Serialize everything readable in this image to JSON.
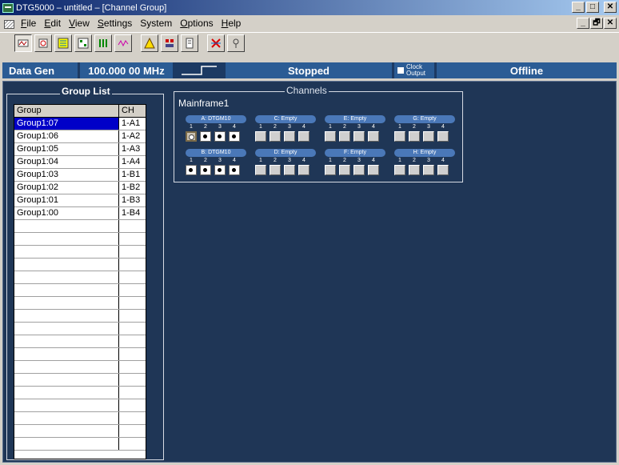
{
  "window": {
    "title": "DTG5000 – untitled – [Channel Group]",
    "controls": [
      "_",
      "□",
      "✕"
    ],
    "mdi_controls": [
      "_",
      "🗗",
      "✕"
    ]
  },
  "menu": {
    "items": [
      {
        "key": "F",
        "rest": "ile"
      },
      {
        "key": "E",
        "rest": "dit"
      },
      {
        "key": "V",
        "rest": "iew"
      },
      {
        "key": "S",
        "rest": "ettings"
      },
      {
        "key": "",
        "rest": "System"
      },
      {
        "key": "O",
        "rest": "ptions"
      },
      {
        "key": "H",
        "rest": "elp"
      }
    ]
  },
  "toolbar": {
    "buttons": [
      "data-gen-icon",
      "settings-icon",
      "pattern-icon",
      "timing-icon",
      "channel-icon",
      "waveform-icon",
      "warning-icon",
      "group-icon",
      "clip-icon",
      "cross-icon",
      "probe-icon"
    ]
  },
  "status": {
    "mode_label": "Data Gen",
    "frequency": "100.000 00 MHz",
    "run_state": "Stopped",
    "clock_output_line1": "Clock",
    "clock_output_line2": "Output",
    "connection": "Offline"
  },
  "group_list": {
    "title": "Group List",
    "columns": [
      "Group",
      "CH"
    ],
    "rows": [
      {
        "group": "Group1:07",
        "ch": "1-A1",
        "selected": true
      },
      {
        "group": "Group1:06",
        "ch": "1-A2",
        "selected": false
      },
      {
        "group": "Group1:05",
        "ch": "1-A3",
        "selected": false
      },
      {
        "group": "Group1:04",
        "ch": "1-A4",
        "selected": false
      },
      {
        "group": "Group1:03",
        "ch": "1-B1",
        "selected": false
      },
      {
        "group": "Group1:02",
        "ch": "1-B2",
        "selected": false
      },
      {
        "group": "Group1:01",
        "ch": "1-B3",
        "selected": false
      },
      {
        "group": "Group1:00",
        "ch": "1-B4",
        "selected": false
      }
    ],
    "empty_rows": 18
  },
  "channels": {
    "title": "Channels",
    "mainframe": "Mainframe1",
    "channel_numbers": [
      "1",
      "2",
      "3",
      "4"
    ],
    "slots": [
      {
        "label": "A: DTGM10",
        "used": true,
        "active_channel": 1
      },
      {
        "label": "C: Empty",
        "used": false,
        "active_channel": 0
      },
      {
        "label": "E: Empty",
        "used": false,
        "active_channel": 0
      },
      {
        "label": "G: Empty",
        "used": false,
        "active_channel": 0
      },
      {
        "label": "B: DTGM10",
        "used": true,
        "active_channel": 0
      },
      {
        "label": "D: Empty",
        "used": false,
        "active_channel": 0
      },
      {
        "label": "F: Empty",
        "used": false,
        "active_channel": 0
      },
      {
        "label": "H: Empty",
        "used": false,
        "active_channel": 0
      }
    ]
  },
  "colors": {
    "status_bg": "#2b5c95",
    "workarea_bg": "#1f3656",
    "selection": "#0000c8",
    "slot_pill": "#4a78b8"
  }
}
